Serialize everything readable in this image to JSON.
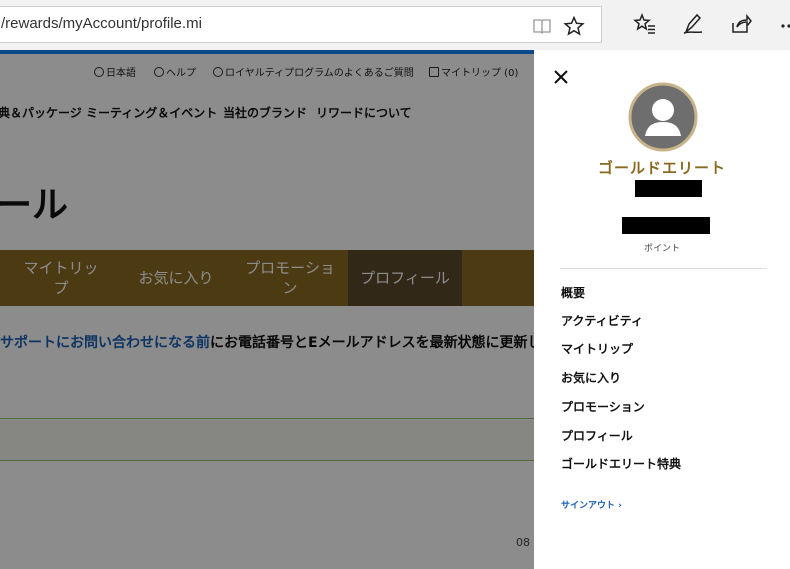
{
  "browser": {
    "url": "/rewards/myAccount/profile.mi",
    "icons": [
      "reading-view-icon",
      "favorite-star-icon",
      "favorites-hub-icon",
      "pen-notes-icon",
      "share-icon",
      "more-icon"
    ]
  },
  "site": {
    "utility_nav": [
      {
        "label": "日本語",
        "icon": "globe-icon"
      },
      {
        "label": "ヘルプ",
        "icon": "question-icon"
      },
      {
        "label": "ロイヤルティプログラムのよくあるご質問",
        "icon": "info-icon"
      },
      {
        "label": "マイトリップ (0)",
        "icon": "suitcase-icon"
      }
    ],
    "main_nav": [
      "典＆パッケージ",
      "ミーティング＆イベント",
      "当社のブランド",
      "リワードについて"
    ],
    "heading": "ール",
    "tabs": [
      {
        "label": "マイトリップ",
        "active": false
      },
      {
        "label": "お気に入り",
        "active": false
      },
      {
        "label": "プロモーション",
        "active": false
      },
      {
        "label": "プロフィール",
        "active": true
      }
    ],
    "notice_link": "サポートにお問い合わせになる前",
    "notice_text": "にお電話番号とEメールアドレスを最新状態に更新し",
    "footer_fragment": "08"
  },
  "panel": {
    "tier": "ゴールドエリート",
    "points_label": "ポイント",
    "menu": [
      "概要",
      "アクティビティ",
      "マイトリップ",
      "お気に入り",
      "プロモーション",
      "プロフィール",
      "ゴールドエリート特典"
    ],
    "signout": "サインアウト",
    "colors": {
      "gold": "#8a6a22",
      "link": "#1a5fb4",
      "avatar_ring": "#c8b48a"
    }
  }
}
